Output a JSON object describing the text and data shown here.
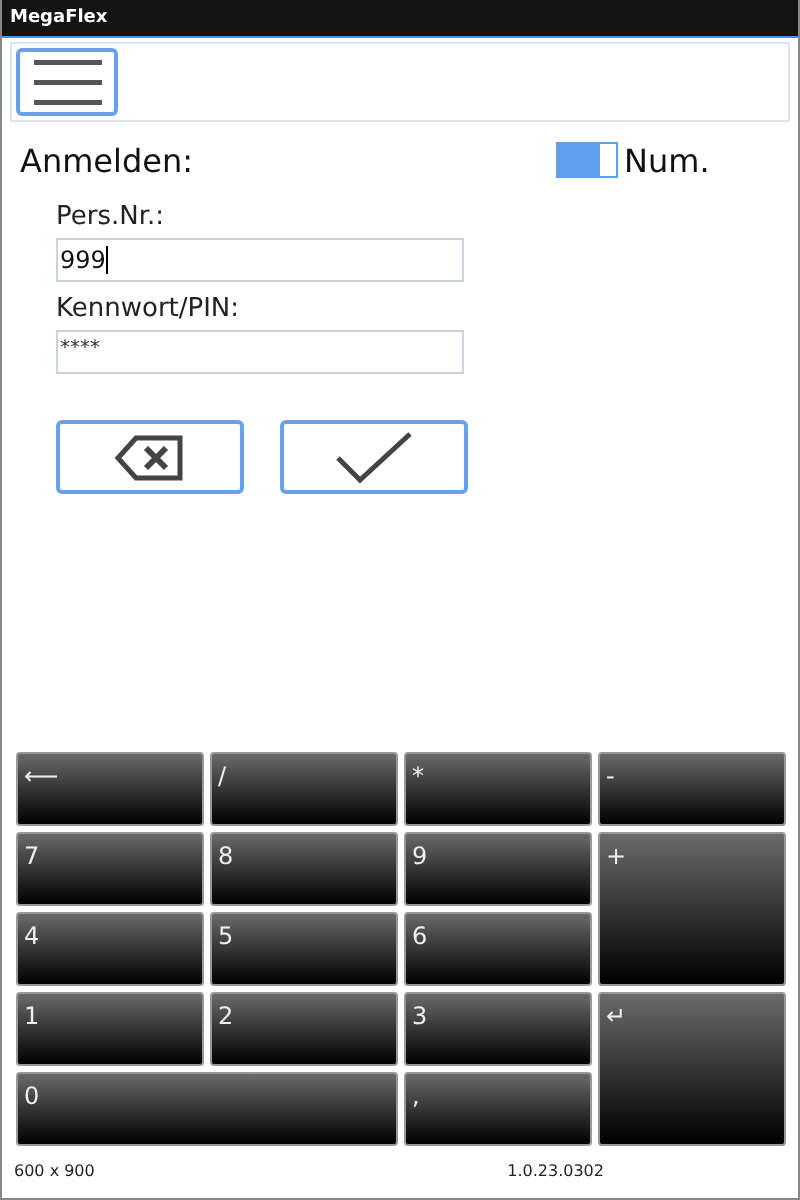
{
  "window": {
    "title": "MegaFlex"
  },
  "heading": "Anmelden:",
  "num_toggle": {
    "label": "Num.",
    "on": true
  },
  "fields": [
    {
      "label": "Pers.Nr.:",
      "value": "999"
    },
    {
      "label": "Kennwort/PIN:",
      "value": "****"
    }
  ],
  "keypad": [
    {
      "label": "⟵",
      "kind": "normal"
    },
    {
      "label": "/",
      "kind": "normal"
    },
    {
      "label": "*",
      "kind": "normal"
    },
    {
      "label": "-",
      "kind": "normal"
    },
    {
      "label": "7",
      "kind": "normal"
    },
    {
      "label": "8",
      "kind": "normal"
    },
    {
      "label": "9",
      "kind": "normal"
    },
    {
      "label": "+",
      "kind": "tall"
    },
    {
      "label": "4",
      "kind": "normal"
    },
    {
      "label": "5",
      "kind": "normal"
    },
    {
      "label": "6",
      "kind": "normal"
    },
    {
      "label": "1",
      "kind": "normal"
    },
    {
      "label": "2",
      "kind": "normal"
    },
    {
      "label": "3",
      "kind": "normal"
    },
    {
      "label": "↵",
      "kind": "tall"
    },
    {
      "label": "0",
      "kind": "wide"
    },
    {
      "label": ",",
      "kind": "normal"
    }
  ],
  "status_bar": {
    "resolution": "600 x 900",
    "version": "1.0.23.0302"
  }
}
